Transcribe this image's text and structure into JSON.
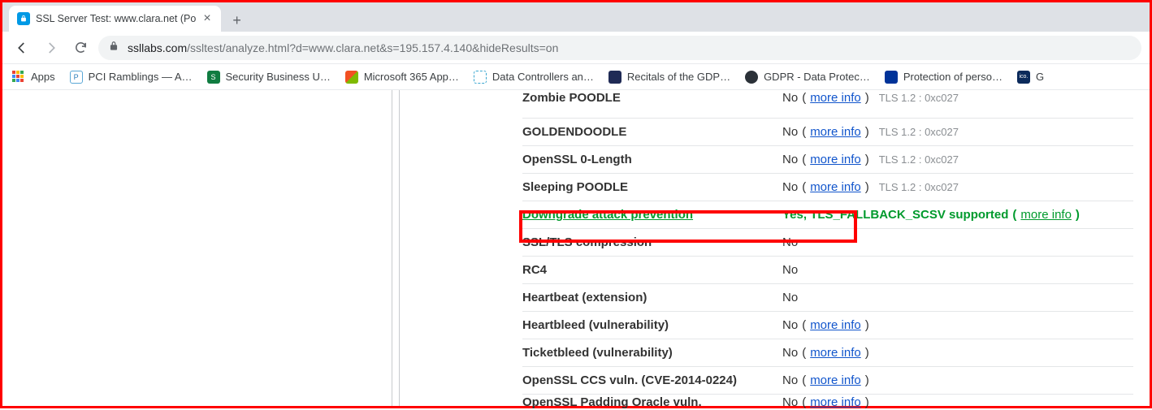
{
  "tab": {
    "title": "SSL Server Test: www.clara.net (Po"
  },
  "url": {
    "host": "ssllabs.com",
    "path": "/ssltest/analyze.html?d=www.clara.net&s=195.157.4.140&hideResults=on"
  },
  "bookmarks": {
    "apps": "Apps",
    "items": [
      {
        "label": "PCI Ramblings — A…"
      },
      {
        "label": "Security Business U…"
      },
      {
        "label": "Microsoft 365 App…"
      },
      {
        "label": "Data Controllers an…"
      },
      {
        "label": "Recitals of the GDP…"
      },
      {
        "label": "GDPR - Data Protec…"
      },
      {
        "label": "Protection of perso…"
      },
      {
        "label": "G"
      }
    ]
  },
  "rows": [
    {
      "label": "Zombie POODLE",
      "value": "No",
      "info": true,
      "meta": "TLS 1.2 : 0xc027",
      "cut": "top"
    },
    {
      "label": "GOLDENDOODLE",
      "value": "No",
      "info": true,
      "meta": "TLS 1.2 : 0xc027"
    },
    {
      "label": "OpenSSL 0-Length",
      "value": "No",
      "info": true,
      "meta": "TLS 1.2 : 0xc027"
    },
    {
      "label": "Sleeping POODLE",
      "value": "No",
      "info": true,
      "meta": "TLS 1.2 : 0xc027"
    },
    {
      "label": "Downgrade attack prevention",
      "value": "Yes, TLS_FALLBACK_SCSV supported",
      "info": true,
      "green": true
    },
    {
      "label": "SSL/TLS compression",
      "value": "No"
    },
    {
      "label": "RC4",
      "value": "No"
    },
    {
      "label": "Heartbeat (extension)",
      "value": "No"
    },
    {
      "label": "Heartbleed (vulnerability)",
      "value": "No",
      "info": true
    },
    {
      "label": "Ticketbleed (vulnerability)",
      "value": "No",
      "info": true
    },
    {
      "label": "OpenSSL CCS vuln. (CVE-2014-0224)",
      "value": "No",
      "info": true
    },
    {
      "label": "OpenSSL Padding Oracle vuln.",
      "value": "No",
      "info": true,
      "cut": "bot"
    }
  ],
  "more_info": "more info"
}
